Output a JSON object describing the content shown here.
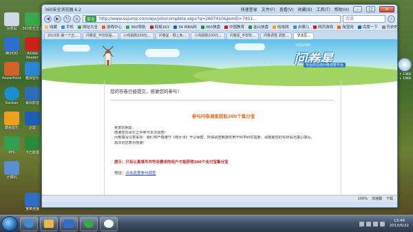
{
  "desktop": {
    "icons": [
      {
        "label": "回收站"
      },
      {
        "label": "360安全卫士"
      },
      {
        "label": "腾讯QQ"
      },
      {
        "label": "Adobe Reader"
      },
      {
        "label": "PowerPoint"
      },
      {
        "label": "酷狗音乐"
      },
      {
        "label": "Kankan"
      },
      {
        "label": "暴风影音"
      },
      {
        "label": "酷我音乐"
      },
      {
        "label": "迅雷"
      },
      {
        "label": "PPS"
      },
      {
        "label": "卡巴斯基"
      },
      {
        "label": "计算机"
      },
      {
        "label": "宽带连接"
      }
    ]
  },
  "browser": {
    "title": "360安全浏览器 6.2",
    "title_right_items": [
      "快速登录",
      "文件(F)",
      "查看(V)",
      "收藏(B)",
      "工具(T)",
      "帮助(H)"
    ],
    "address": {
      "safe_label": "安全",
      "url": "http://www.sojump.com/wjx/join/complete.aspx?q=2667410&JoinID=7451..."
    },
    "search_placeholder": "百度",
    "favorites": [
      "收藏",
      "手机",
      "网址大全",
      "游戏中心",
      "360导航",
      "网易163",
      "34 MBA网",
      "360快盘",
      "中国教育",
      "金山快盘",
      "哈哈网",
      "去哪儿",
      "网页游戏",
      "淘宝网",
      "百度一下",
      "历史的风"
    ],
    "tabs": [
      {
        "label": "2013年 第一个正...",
        "active": false
      },
      {
        "label": "问卷星_不仅仅是...",
        "active": false
      },
      {
        "label": "小鸡捐款200元...",
        "active": false
      },
      {
        "label": "问卷星 - 网上免...",
        "active": false
      },
      {
        "label": "小鸡捐款200元...",
        "active": false
      },
      {
        "label": "问卷星_不仅仅...",
        "active": false
      },
      {
        "label": "问卷调查  调查...",
        "active": false
      },
      {
        "label": "华北区...",
        "active": true
      }
    ],
    "status": {
      "items": [
        "100%",
        "加速器",
        "下载"
      ]
    }
  },
  "page": {
    "logo": {
      "sub": "SOJUMP",
      "main": "问卷星",
      "tag": "专业的在线问卷调查平台"
    },
    "thanks": "您的答卷已经提交，感谢您的参与！",
    "promo_title": "参与问卷调查获取200个集分宝",
    "paragraph_lines": [
      "亲爱的朋友：",
      "    感谢您在百忙之中参与本次调查！",
      "    问卷填写注意事项：我们将严格遵守《统计法》予以保密，所得调查数据仅用于科学研究需要，请根据您的实际情况填心填写。",
      "    再次对您表示感谢！"
    ],
    "notice": "提示：只有认真填写并符合要求的用户才能获得200个支付宝集分宝",
    "address_label": "地址：",
    "address_link": "点击这里参与调查"
  },
  "gadget": {
    "lines": [
      "↑ 13KB",
      "↓ 10KB"
    ]
  },
  "taskbar": {
    "clock_time": "13:49",
    "clock_date": "2013/6/22"
  },
  "colors": {
    "promo": "#e06a16",
    "notice": "#c81e1e",
    "link": "#1a3fbf"
  }
}
